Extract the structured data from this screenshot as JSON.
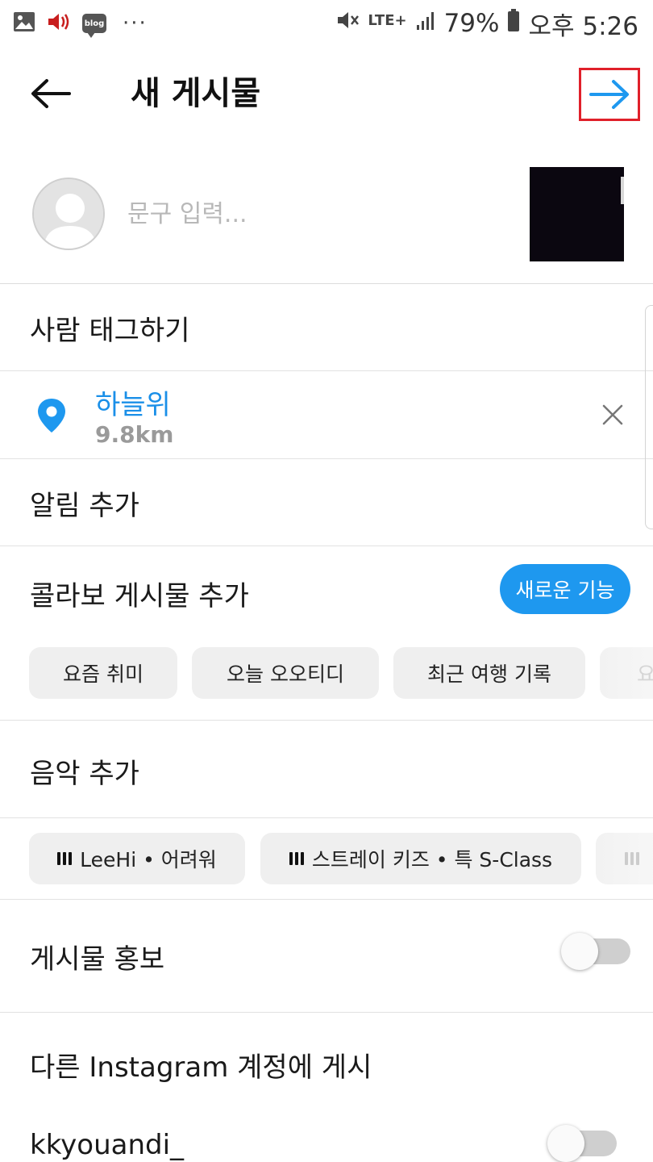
{
  "status_bar": {
    "icons_left": [
      "image-icon",
      "speaker-icon",
      "blog-icon",
      "more-dots-icon"
    ],
    "blog_badge_text": "blog",
    "dots": "···",
    "network": "LTE+",
    "battery": "79%",
    "time": "오후 5:26"
  },
  "header": {
    "title": "새 게시물",
    "back_icon": "arrow-left-icon",
    "next_icon": "arrow-right-icon",
    "accent_color": "#1e98ef",
    "highlight_color": "#e0202a"
  },
  "caption": {
    "value": "",
    "placeholder": "문구 입력..."
  },
  "tag_people": {
    "label": "사람 태그하기"
  },
  "location": {
    "name": "하늘위",
    "distance": "9.8km",
    "icon": "location-pin-icon"
  },
  "notice": {
    "label": "알림 추가"
  },
  "collab": {
    "label": "콜라보 게시물 추가",
    "badge": "새로운 기능",
    "chips": [
      "요즘 취미",
      "오늘 오오티디",
      "최근 여행 기록",
      "요"
    ]
  },
  "music": {
    "label": "음악 추가",
    "chips": [
      "LeeHi • 어려워",
      "스트레이 키즈 • 특 S-Class",
      ""
    ]
  },
  "promotion": {
    "label": "게시물 홍보",
    "enabled": false
  },
  "share": {
    "title": "다른 Instagram 계정에 게시",
    "account": "kkyouandi_",
    "enabled": false
  }
}
